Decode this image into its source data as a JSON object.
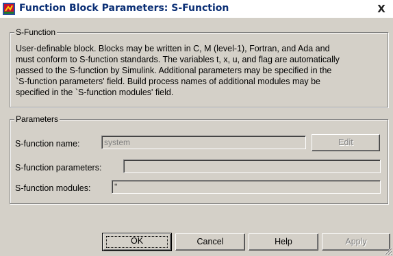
{
  "window": {
    "title": "Function Block Parameters: S-Function",
    "close_glyph": "X",
    "icon": "simulink-block-icon"
  },
  "sfunction_group": {
    "legend": "S-Function",
    "description_lines": [
      "User-definable block.  Blocks may be written in C, M (level-1), Fortran, and Ada and",
      "must conform to S-function standards.  The variables t, x, u, and flag are automatically",
      "passed to the S-function by Simulink.  Additional parameters may be specified in the",
      "`S-function parameters' field. Build process names of additional modules may be",
      "specified in the `S-function modules' field."
    ]
  },
  "parameters_group": {
    "legend": "Parameters",
    "name_label": "S-function name:",
    "name_value": "system",
    "edit_label": "Edit",
    "params_label": "S-function parameters:",
    "params_value": "",
    "modules_label": "S-function modules:",
    "modules_value": "''"
  },
  "buttons": {
    "ok": "OK",
    "cancel": "Cancel",
    "help": "Help",
    "apply": "Apply"
  },
  "colors": {
    "dialog_bg": "#d4d0c8",
    "title_text": "#0b2f75",
    "disabled_text": "#808080"
  }
}
